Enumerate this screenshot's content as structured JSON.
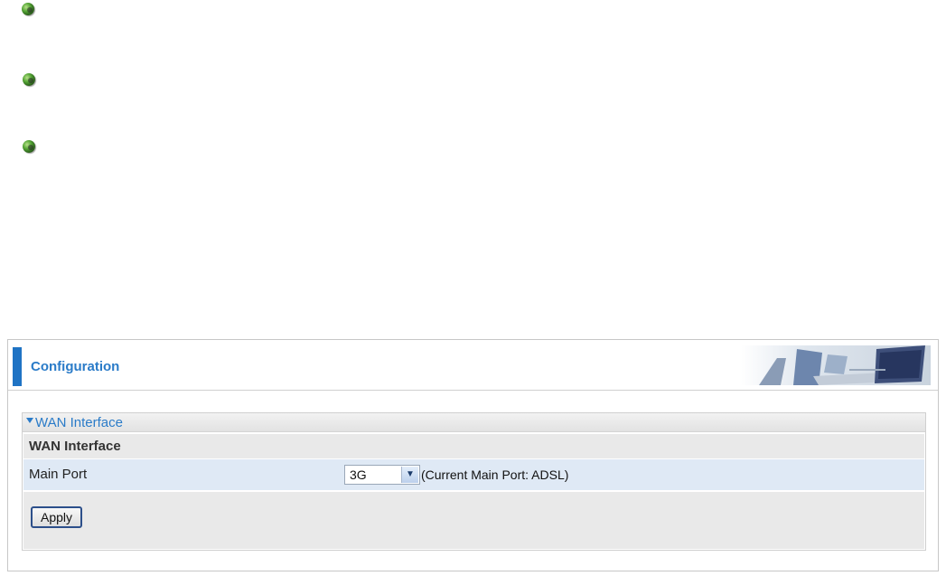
{
  "header": {
    "title": "Configuration",
    "accent": "#1f73c4"
  },
  "wan_section": {
    "title": "WAN Interface",
    "subheading": "WAN Interface",
    "main_port": {
      "label": "Main Port",
      "selected": "3G",
      "note": "(Current Main Port: ADSL)"
    },
    "apply_label": "Apply"
  }
}
